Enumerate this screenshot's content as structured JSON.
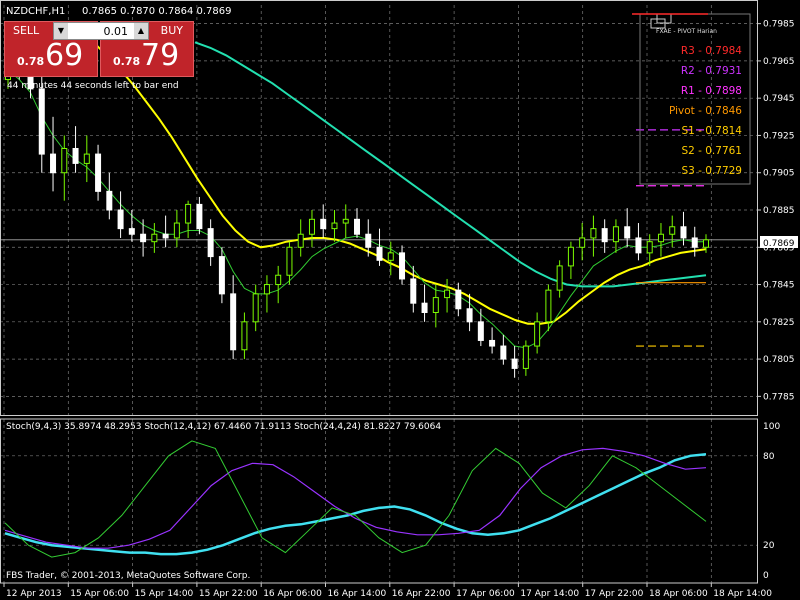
{
  "header": {
    "symbol": "NZDCHF,H1",
    "ohlc": "0.7865 0.7870 0.7864 0.7869"
  },
  "trade_panel": {
    "sell_label": "SELL",
    "buy_label": "BUY",
    "lot": "0.01",
    "sell_small": "0.78",
    "sell_big": "69",
    "buy_small": "0.78",
    "buy_big": "79",
    "timer_text": "44 minutes 44 seconds left to bar end"
  },
  "pivot_panel": {
    "title": "FXAE - PIVOT Harian",
    "levels": [
      {
        "label": "R3 - 0.7984",
        "color": "#ff2a2a"
      },
      {
        "label": "R2 - 0.7931",
        "color": "#cc33ff"
      },
      {
        "label": "R1 - 0.7898",
        "color": "#ff33ff"
      },
      {
        "label": "Pivot - 0.7846",
        "color": "#ff9900"
      },
      {
        "label": "S1 - 0.7814",
        "color": "#ffcc00"
      },
      {
        "label": "S2 - 0.7761",
        "color": "#ffcc00"
      },
      {
        "label": "S3 - 0.7729",
        "color": "#ffcc00"
      }
    ]
  },
  "stoch_header": "Stoch(9,4,3) 35.8974 48.2953  Stoch(12,4,12) 67.4460 71.9113  Stoch(24,4,24) 81.8227 79.6064",
  "copyright": "FBS Trader, © 2001-2013, MetaQuotes Software Corp.",
  "current_price": "0.7869",
  "colors": {
    "bull": "#7CFC00",
    "bear": "#ffffff",
    "ma_yellow": "#ffff00",
    "ma_teal": "#22e0b0",
    "ma_green": "#32cd32",
    "stoch_cyan": "#40e0f0",
    "stoch_purple": "#9933ff",
    "stoch_green": "#33cc33",
    "grid": "#7a7a7a",
    "price_box": "#ffffff"
  },
  "chart_data": [
    {
      "type": "candlestick",
      "symbol": "NZDCHF",
      "timeframe": "H1",
      "ylim": [
        0.7775,
        0.7995
      ],
      "y_ticks": [
        "0.7985",
        "0.7965",
        "0.7945",
        "0.7925",
        "0.7905",
        "0.7885",
        "0.7865",
        "0.7845",
        "0.7825",
        "0.7805",
        "0.7785"
      ],
      "x_ticks": [
        "12 Apr 2013",
        "15 Apr 06:00",
        "15 Apr 14:00",
        "15 Apr 22:00",
        "16 Apr 06:00",
        "16 Apr 14:00",
        "16 Apr 22:00",
        "17 Apr 06:00",
        "17 Apr 14:00",
        "17 Apr 22:00",
        "18 Apr 06:00",
        "18 Apr 14:00"
      ],
      "ohlc": [
        [
          0.7955,
          0.797,
          0.795,
          0.7965
        ],
        [
          0.7965,
          0.798,
          0.7955,
          0.796
        ],
        [
          0.796,
          0.7975,
          0.7945,
          0.795
        ],
        [
          0.795,
          0.796,
          0.7905,
          0.7915
        ],
        [
          0.7915,
          0.7935,
          0.7895,
          0.7905
        ],
        [
          0.7905,
          0.7925,
          0.789,
          0.7918
        ],
        [
          0.7918,
          0.793,
          0.7905,
          0.791
        ],
        [
          0.791,
          0.7925,
          0.79,
          0.7915
        ],
        [
          0.7915,
          0.792,
          0.789,
          0.7895
        ],
        [
          0.7895,
          0.7905,
          0.788,
          0.7885
        ],
        [
          0.7885,
          0.7895,
          0.787,
          0.7875
        ],
        [
          0.7875,
          0.7885,
          0.7868,
          0.7872
        ],
        [
          0.7872,
          0.788,
          0.786,
          0.7868
        ],
        [
          0.7868,
          0.7878,
          0.7862,
          0.7872
        ],
        [
          0.7872,
          0.7882,
          0.7865,
          0.787
        ],
        [
          0.787,
          0.7885,
          0.7865,
          0.7878
        ],
        [
          0.7878,
          0.789,
          0.787,
          0.7888
        ],
        [
          0.7888,
          0.7892,
          0.7872,
          0.7875
        ],
        [
          0.7875,
          0.788,
          0.7855,
          0.786
        ],
        [
          0.786,
          0.7865,
          0.7835,
          0.784
        ],
        [
          0.784,
          0.785,
          0.7805,
          0.781
        ],
        [
          0.781,
          0.783,
          0.7805,
          0.7825
        ],
        [
          0.7825,
          0.7845,
          0.782,
          0.784
        ],
        [
          0.784,
          0.785,
          0.783,
          0.7845
        ],
        [
          0.7845,
          0.7855,
          0.7835,
          0.785
        ],
        [
          0.785,
          0.7868,
          0.7845,
          0.7865
        ],
        [
          0.7865,
          0.788,
          0.786,
          0.7872
        ],
        [
          0.7872,
          0.7885,
          0.7865,
          0.788
        ],
        [
          0.788,
          0.7888,
          0.787,
          0.7875
        ],
        [
          0.7875,
          0.7885,
          0.7868,
          0.7878
        ],
        [
          0.7878,
          0.7888,
          0.787,
          0.788
        ],
        [
          0.788,
          0.7886,
          0.787,
          0.7872
        ],
        [
          0.7872,
          0.788,
          0.786,
          0.7865
        ],
        [
          0.7865,
          0.7875,
          0.7855,
          0.7858
        ],
        [
          0.7858,
          0.7868,
          0.785,
          0.7862
        ],
        [
          0.7862,
          0.7866,
          0.7845,
          0.7848
        ],
        [
          0.7848,
          0.7855,
          0.783,
          0.7835
        ],
        [
          0.7835,
          0.7845,
          0.7825,
          0.783
        ],
        [
          0.783,
          0.7845,
          0.7822,
          0.7838
        ],
        [
          0.7838,
          0.7848,
          0.783,
          0.7842
        ],
        [
          0.7842,
          0.7846,
          0.7828,
          0.7832
        ],
        [
          0.7832,
          0.784,
          0.782,
          0.7825
        ],
        [
          0.7825,
          0.7832,
          0.7812,
          0.7815
        ],
        [
          0.7815,
          0.7822,
          0.7808,
          0.7812
        ],
        [
          0.7812,
          0.7818,
          0.7802,
          0.7805
        ],
        [
          0.7805,
          0.7812,
          0.7795,
          0.78
        ],
        [
          0.78,
          0.7815,
          0.7796,
          0.7812
        ],
        [
          0.7812,
          0.783,
          0.7808,
          0.7825
        ],
        [
          0.7825,
          0.7845,
          0.782,
          0.7842
        ],
        [
          0.7842,
          0.7858,
          0.7838,
          0.7855
        ],
        [
          0.7855,
          0.7868,
          0.7848,
          0.7865
        ],
        [
          0.7865,
          0.7878,
          0.7858,
          0.787
        ],
        [
          0.787,
          0.7882,
          0.786,
          0.7875
        ],
        [
          0.7875,
          0.788,
          0.7862,
          0.7868
        ],
        [
          0.7868,
          0.788,
          0.7862,
          0.7876
        ],
        [
          0.7876,
          0.7886,
          0.7865,
          0.787
        ],
        [
          0.787,
          0.7878,
          0.7858,
          0.7862
        ],
        [
          0.7862,
          0.7872,
          0.7855,
          0.7868
        ],
        [
          0.7868,
          0.7878,
          0.786,
          0.7872
        ],
        [
          0.7872,
          0.7882,
          0.7865,
          0.7876
        ],
        [
          0.7876,
          0.7884,
          0.7866,
          0.787
        ],
        [
          0.787,
          0.7876,
          0.786,
          0.7865
        ],
        [
          0.7865,
          0.7872,
          0.7862,
          0.7869
        ]
      ],
      "ma_green": [
        0.796,
        0.7955,
        0.7948,
        0.7935,
        0.7925,
        0.7917,
        0.7912,
        0.7908,
        0.7902,
        0.7895,
        0.7888,
        0.7882,
        0.7877,
        0.7874,
        0.7872,
        0.7872,
        0.7874,
        0.7874,
        0.7871,
        0.7864,
        0.7852,
        0.7843,
        0.784,
        0.784,
        0.7842,
        0.7847,
        0.7853,
        0.786,
        0.7864,
        0.7867,
        0.787,
        0.7871,
        0.7869,
        0.7866,
        0.7864,
        0.786,
        0.7853,
        0.7846,
        0.7842,
        0.7841,
        0.7839,
        0.7835,
        0.7829,
        0.7824,
        0.7818,
        0.7812,
        0.7811,
        0.7814,
        0.7821,
        0.783,
        0.7839,
        0.7847,
        0.7855,
        0.7859,
        0.7863,
        0.7866,
        0.7865,
        0.7865,
        0.7866,
        0.7868,
        0.7869,
        0.7868,
        0.7868
      ],
      "ma_yellow": [
        0.7985,
        0.798,
        0.7974,
        0.7967,
        0.796,
        0.7952,
        0.7943,
        0.7934,
        0.7924,
        0.7913,
        0.7902,
        0.7892,
        0.7882,
        0.7874,
        0.7868,
        0.7865,
        0.7866,
        0.7868,
        0.7869,
        0.787,
        0.787,
        0.7869,
        0.7867,
        0.7864,
        0.7861,
        0.7857,
        0.7854,
        0.785,
        0.7847,
        0.7845,
        0.7843,
        0.784,
        0.7836,
        0.7832,
        0.7829,
        0.7826,
        0.7824,
        0.7824,
        0.7825,
        0.783,
        0.7836,
        0.7841,
        0.7846,
        0.785,
        0.7853,
        0.7855,
        0.7858,
        0.786,
        0.7862,
        0.7863,
        0.7864
      ],
      "ma_teal": [
        0.7975,
        0.7972,
        0.7968,
        0.7963,
        0.7958,
        0.7953,
        0.7947,
        0.7941,
        0.7935,
        0.7929,
        0.7923,
        0.7917,
        0.7911,
        0.7905,
        0.7899,
        0.7893,
        0.7887,
        0.7881,
        0.7875,
        0.7869,
        0.7863,
        0.7857,
        0.7852,
        0.7848,
        0.7845,
        0.7844,
        0.7844,
        0.7844,
        0.7845,
        0.7846,
        0.7847,
        0.7848,
        0.7849,
        0.785
      ]
    },
    {
      "type": "line",
      "title": "Stoch(9,4,3) 35.8974 48.2953  Stoch(12,4,12) 67.4460 71.9113  Stoch(24,4,24) 81.8227 79.6064",
      "ylim": [
        0,
        100
      ],
      "y_ticks": [
        "100",
        "80",
        "20",
        "0"
      ],
      "series": [
        {
          "name": "Stoch(24,4,24)",
          "color": "#40e0f0",
          "values": [
            28,
            25,
            22,
            20,
            19,
            18,
            17,
            16,
            15,
            15,
            14,
            14,
            15,
            17,
            20,
            24,
            28,
            31,
            33,
            34,
            36,
            38,
            40,
            43,
            45,
            46,
            44,
            40,
            35,
            31,
            28,
            27,
            28,
            30,
            34,
            38,
            43,
            48,
            53,
            58,
            63,
            68,
            72,
            77,
            80,
            81
          ]
        },
        {
          "name": "Stoch(12,4,12)",
          "color": "#9933ff",
          "values": [
            30,
            26,
            22,
            20,
            18,
            18,
            20,
            24,
            30,
            45,
            60,
            70,
            75,
            74,
            66,
            56,
            46,
            38,
            32,
            29,
            27,
            27,
            28,
            30,
            40,
            58,
            72,
            80,
            84,
            85,
            83,
            80,
            75,
            71,
            72
          ]
        },
        {
          "name": "Stoch(9,4,3)",
          "color": "#33cc33",
          "values": [
            35,
            20,
            12,
            15,
            25,
            40,
            60,
            80,
            90,
            85,
            55,
            25,
            15,
            30,
            45,
            40,
            25,
            15,
            20,
            40,
            70,
            85,
            75,
            55,
            45,
            60,
            80,
            72,
            60,
            48,
            36
          ]
        }
      ]
    }
  ]
}
